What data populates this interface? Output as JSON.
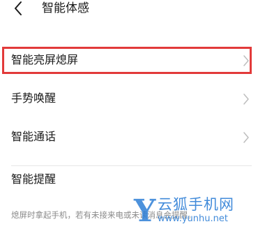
{
  "header": {
    "title": "智能体感",
    "back_icon": "chevron-left-icon"
  },
  "items": [
    {
      "label": "智能亮屏熄屏",
      "highlighted": true
    },
    {
      "label": "手势唤醒"
    },
    {
      "label": "智能通话"
    }
  ],
  "smart_reminder": {
    "label": "智能提醒",
    "description": "熄屏时拿起手机，若有未接来电或未读消息会提醒。"
  },
  "watermark": {
    "logo_letter": "Y",
    "name": "云狐手机网",
    "url": "www.yunhu.net"
  },
  "colors": {
    "highlight_border": "#e23a3a",
    "watermark": "#2e7fd6",
    "chevron": "#bdbdbd"
  }
}
